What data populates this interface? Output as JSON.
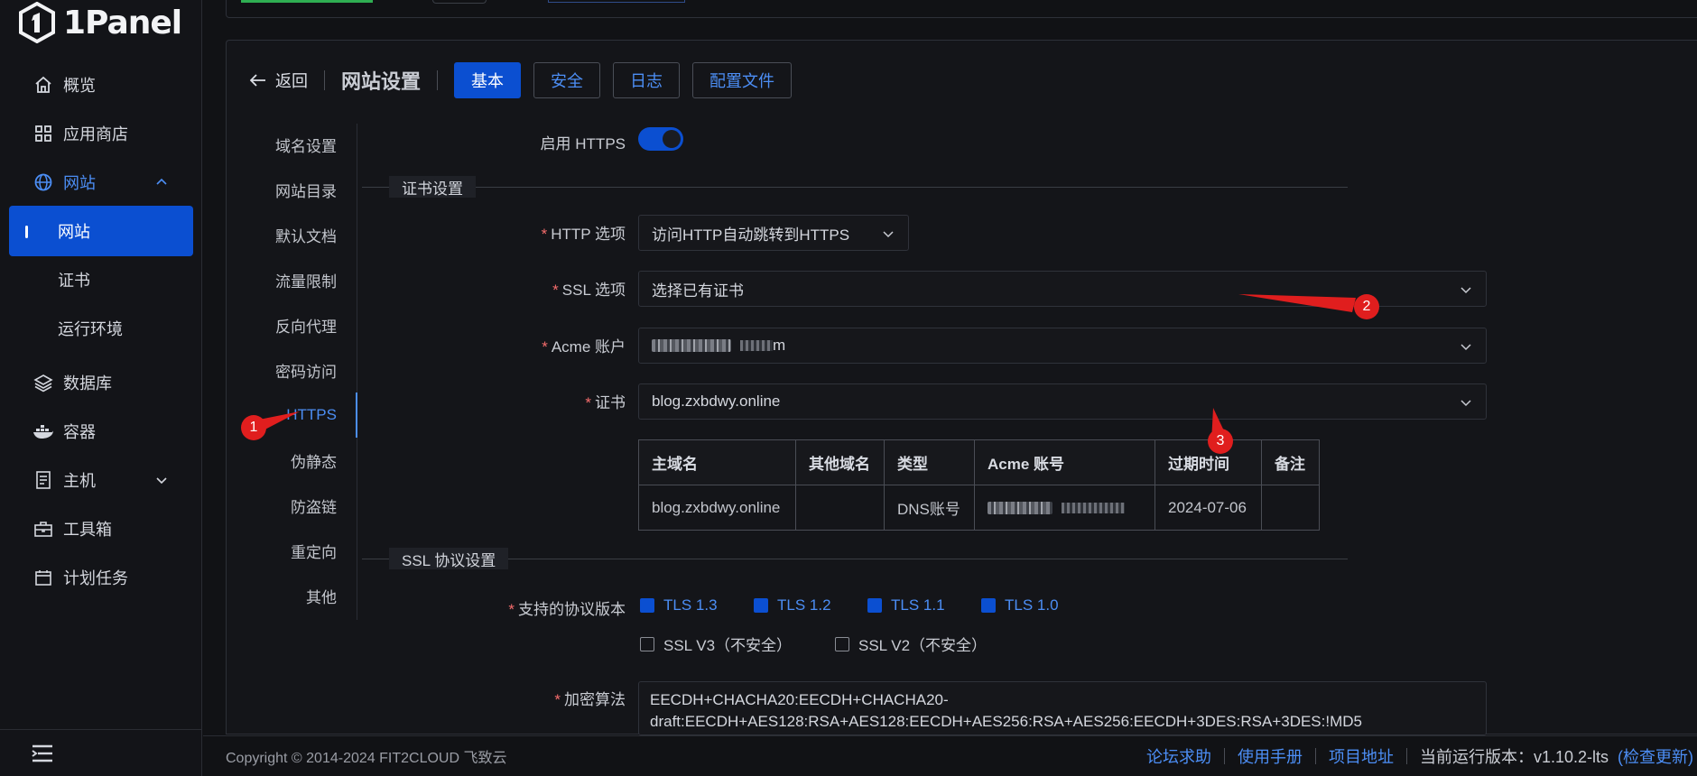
{
  "brand": {
    "name": "1Panel"
  },
  "sidebar": {
    "items": [
      {
        "label": "概览",
        "icon": "home-icon"
      },
      {
        "label": "应用商店",
        "icon": "grid-icon"
      },
      {
        "label": "网站",
        "icon": "globe-icon",
        "open": true
      },
      {
        "label": "网站",
        "sub": true,
        "active": true
      },
      {
        "label": "证书",
        "sub": true
      },
      {
        "label": "运行环境",
        "sub": true
      },
      {
        "label": "数据库",
        "icon": "layers-icon"
      },
      {
        "label": "容器",
        "icon": "docker-icon"
      },
      {
        "label": "主机",
        "icon": "server-icon"
      },
      {
        "label": "工具箱",
        "icon": "toolbox-icon"
      },
      {
        "label": "计划任务",
        "icon": "calendar-icon"
      }
    ]
  },
  "header": {
    "back_label": "返回",
    "title": "网站设置",
    "tabs": [
      {
        "label": "基本",
        "active": true
      },
      {
        "label": "安全"
      },
      {
        "label": "日志"
      },
      {
        "label": "配置文件"
      }
    ]
  },
  "submenu": {
    "items": [
      "域名设置",
      "网站目录",
      "默认文档",
      "流量限制",
      "反向代理",
      "密码访问",
      "HTTPS",
      "伪静态",
      "防盗链",
      "重定向",
      "其他"
    ],
    "active": "HTTPS"
  },
  "form": {
    "enable_https_label": "启用 HTTPS",
    "enable_https": true,
    "cert_section": "证书设置",
    "http_option_label": "HTTP 选项",
    "http_option_value": "访问HTTP自动跳转到HTTPS",
    "ssl_option_label": "SSL 选项",
    "ssl_option_value": "选择已有证书",
    "acme_label": "Acme 账户",
    "acme_value_tail": "m",
    "cert_label": "证书",
    "cert_value": "blog.zxbdwy.online",
    "table": {
      "headers": [
        "主域名",
        "其他域名",
        "类型",
        "Acme 账号",
        "过期时间",
        "备注"
      ],
      "row": {
        "primary": "blog.zxbdwy.online",
        "other": "",
        "type": "DNS账号",
        "expire": "2024-07-06",
        "note": ""
      }
    },
    "ssl_section": "SSL 协议设置",
    "protocols_label": "支持的协议版本",
    "protocols_on": [
      "TLS 1.3",
      "TLS 1.2",
      "TLS 1.1",
      "TLS 1.0"
    ],
    "protocols_off": [
      "SSL V3（不安全）",
      "SSL V2（不安全）"
    ],
    "cipher_label": "加密算法",
    "cipher_line1": "EECDH+CHACHA20:EECDH+CHACHA20-",
    "cipher_line2": "draft:EECDH+AES128:RSA+AES128:EECDH+AES256:RSA+AES256:EECDH+3DES:RSA+3DES:!MD5"
  },
  "annotations": [
    "1",
    "2",
    "3"
  ],
  "footer": {
    "copyright": "Copyright © 2014-2024 FIT2CLOUD 飞致云",
    "links": [
      "论坛求助",
      "使用手册",
      "项目地址"
    ],
    "version": "当前运行版本：v1.10.2-lts",
    "check_update": "(检查更新)"
  },
  "colors": {
    "accent": "#0b4fd1",
    "link": "#4c8ef5",
    "marker": "#e01e1e",
    "bg": "#111215"
  }
}
